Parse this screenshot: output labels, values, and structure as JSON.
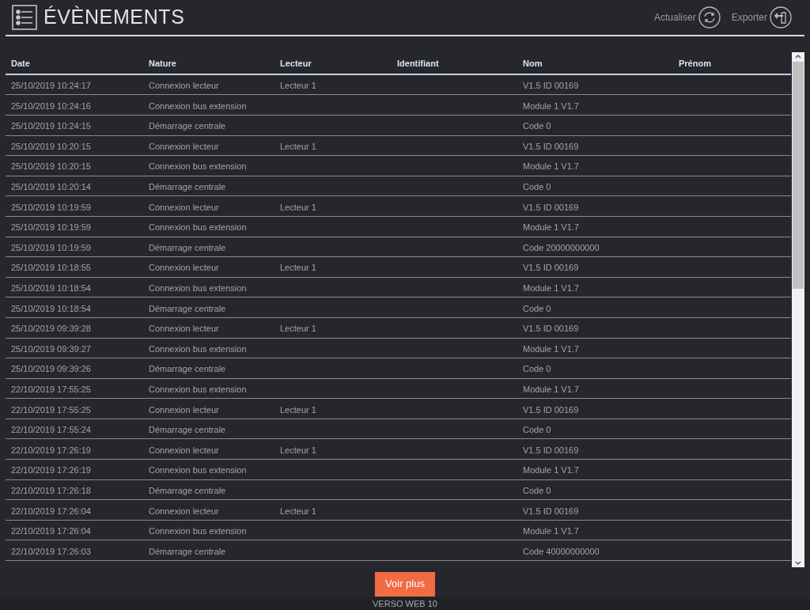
{
  "header": {
    "title": "ÉVÈNEMENTS",
    "actions": [
      {
        "label": "Actualiser",
        "kind": "refresh"
      },
      {
        "label": "Exporter",
        "kind": "export"
      }
    ]
  },
  "table": {
    "columns": [
      "Date",
      "Nature",
      "Lecteur",
      "Identifiant",
      "Nom",
      "Prénom"
    ],
    "rows": [
      {
        "date": "25/10/2019 10:24:17",
        "nature": "Connexion lecteur",
        "lecteur": "Lecteur 1",
        "nom": "V1.5 ID 00169"
      },
      {
        "date": "25/10/2019 10:24:16",
        "nature": "Connexion bus extension",
        "nom": "Module 1 V1.7"
      },
      {
        "date": "25/10/2019 10:24:15",
        "nature": "Démarrage centrale",
        "nom": "Code 0"
      },
      {
        "date": "25/10/2019 10:20:15",
        "nature": "Connexion lecteur",
        "lecteur": "Lecteur 1",
        "nom": "V1.5 ID 00169"
      },
      {
        "date": "25/10/2019 10:20:15",
        "nature": "Connexion bus extension",
        "nom": "Module 1 V1.7"
      },
      {
        "date": "25/10/2019 10:20:14",
        "nature": "Démarrage centrale",
        "nom": "Code 0"
      },
      {
        "date": "25/10/2019 10:19:59",
        "nature": "Connexion lecteur",
        "lecteur": "Lecteur 1",
        "nom": "V1.5 ID 00169"
      },
      {
        "date": "25/10/2019 10:19:59",
        "nature": "Connexion bus extension",
        "nom": "Module 1 V1.7"
      },
      {
        "date": "25/10/2019 10:19:59",
        "nature": "Démarrage centrale",
        "nom": "Code 20000000000"
      },
      {
        "date": "25/10/2019 10:18:55",
        "nature": "Connexion lecteur",
        "lecteur": "Lecteur 1",
        "nom": "V1.5 ID 00169"
      },
      {
        "date": "25/10/2019 10:18:54",
        "nature": "Connexion bus extension",
        "nom": "Module 1 V1.7"
      },
      {
        "date": "25/10/2019 10:18:54",
        "nature": "Démarrage centrale",
        "nom": "Code 0"
      },
      {
        "date": "25/10/2019 09:39:28",
        "nature": "Connexion lecteur",
        "lecteur": "Lecteur 1",
        "nom": "V1.5 ID 00169"
      },
      {
        "date": "25/10/2019 09:39:27",
        "nature": "Connexion bus extension",
        "nom": "Module 1 V1.7"
      },
      {
        "date": "25/10/2019 09:39:26",
        "nature": "Démarrage centrale",
        "nom": "Code 0"
      },
      {
        "date": "22/10/2019 17:55:25",
        "nature": "Connexion bus extension",
        "nom": "Module 1 V1.7"
      },
      {
        "date": "22/10/2019 17:55:25",
        "nature": "Connexion lecteur",
        "lecteur": "Lecteur 1",
        "nom": "V1.5 ID 00169"
      },
      {
        "date": "22/10/2019 17:55:24",
        "nature": "Démarrage centrale",
        "nom": "Code 0"
      },
      {
        "date": "22/10/2019 17:26:19",
        "nature": "Connexion lecteur",
        "lecteur": "Lecteur 1",
        "nom": "V1.5 ID 00169"
      },
      {
        "date": "22/10/2019 17:26:19",
        "nature": "Connexion bus extension",
        "nom": "Module 1 V1.7"
      },
      {
        "date": "22/10/2019 17:26:18",
        "nature": "Démarrage centrale",
        "nom": "Code 0"
      },
      {
        "date": "22/10/2019 17:26:04",
        "nature": "Connexion lecteur",
        "lecteur": "Lecteur 1",
        "nom": "V1.5 ID 00169"
      },
      {
        "date": "22/10/2019 17:26:04",
        "nature": "Connexion bus extension",
        "nom": "Module 1 V1.7"
      },
      {
        "date": "22/10/2019 17:26:03",
        "nature": "Démarrage centrale",
        "nom": "Code 40000000000"
      }
    ]
  },
  "more_button": "Voir plus",
  "footer": "VERSO WEB 10"
}
